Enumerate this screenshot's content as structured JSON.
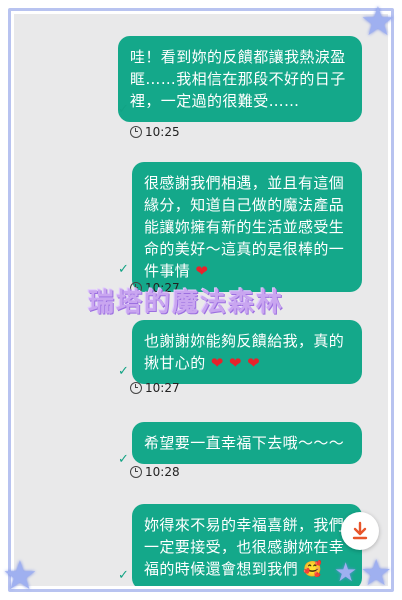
{
  "messages": [
    {
      "text": "哇！看到妳的反饋都讓我熱淚盈眶……我相信在那段不好的日子裡，一定過的很難受……",
      "time": "10:25"
    },
    {
      "text": "很感謝我們相遇，並且有這個緣分，知道自己做的魔法產品能讓妳擁有新的生活並感受生命的美好～這真的是很棒的一件事情",
      "time": "10:27"
    },
    {
      "text": "也謝謝妳能夠反饋給我，真的揪甘心的",
      "time": "10:27"
    },
    {
      "text": "希望要一直幸福下去哦～～～",
      "time": "10:28"
    },
    {
      "text": "妳得來不易的幸福喜餅，我們一定要接受，也很感謝妳在幸福的時候還會想到我們",
      "time": ""
    }
  ],
  "watermark": "瑞塔的魔法森林",
  "colors": {
    "bubble": "#14a88a",
    "background": "#e9e9ea",
    "frame": "#b8c3f0"
  },
  "icons": {
    "status": "check-icon",
    "time": "clock-icon",
    "download": "download-arrow-icon"
  }
}
